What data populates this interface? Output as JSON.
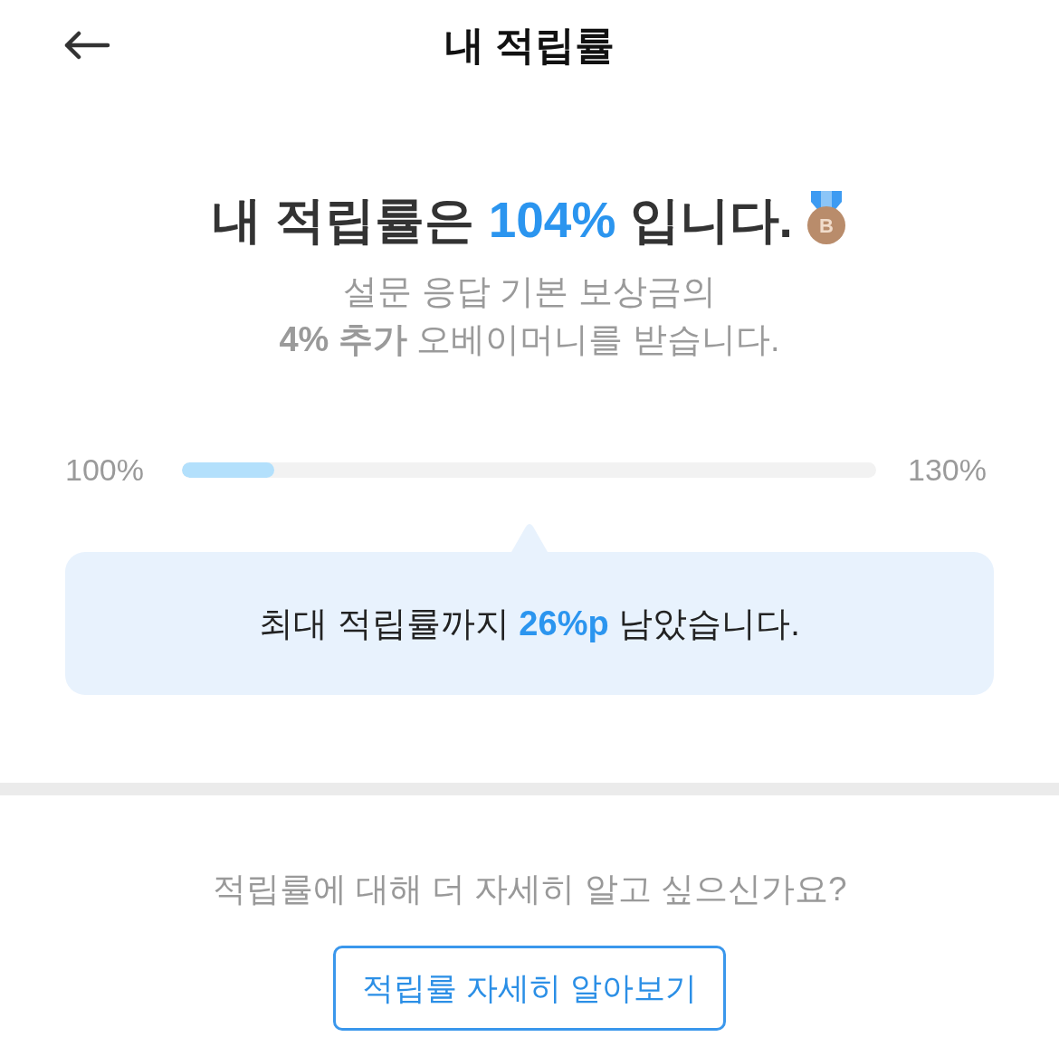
{
  "header": {
    "title": "내 적립률"
  },
  "summary": {
    "headline": [
      {
        "text": "내 적립률은 ",
        "highlight": false
      },
      {
        "text": "104%",
        "highlight": true
      },
      {
        "text": " 입니다.",
        "highlight": false
      }
    ],
    "medal_letter": "B",
    "description": [
      "설문 응답 기본 보상금의",
      "**4% 추가** 오베이머니를 받습니다."
    ]
  },
  "progress": {
    "min_label": "100%",
    "max_label": "130%",
    "level": 0.133
  },
  "bubble": {
    "parts": [
      {
        "text": "최대 적립률까지 ",
        "highlight": false
      },
      {
        "text": "26%p",
        "highlight": true
      },
      {
        "text": " 남았습니다.",
        "highlight": false
      }
    ]
  },
  "more_info": {
    "question": "적립률에 대해 더 자세히 알고 싶으신가요?",
    "button": "적립률 자세히 알아보기"
  }
}
